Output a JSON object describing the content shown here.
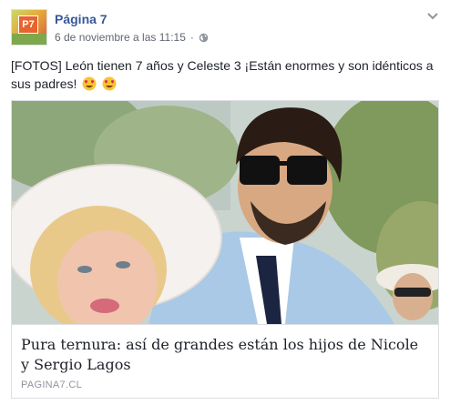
{
  "header": {
    "page_name": "Página 7",
    "timestamp": "6 de noviembre a las 11:15",
    "separator": "·",
    "avatar_text": "P7"
  },
  "post": {
    "text": "[FOTOS] León tienen 7 años y Celeste 3 ¡Están enormes y son idénticos a sus padres!",
    "emojis": [
      "heart-eyes-emoji",
      "heart-eyes-emoji"
    ]
  },
  "link_card": {
    "title": "Pura ternura: así de grandes están los hijos de Nicole y Sergio Lagos",
    "domain": "PAGINA7.CL"
  },
  "icons": {
    "privacy": "globe-icon",
    "options": "chevron-down-icon"
  },
  "colors": {
    "link_blue": "#365899",
    "meta_gray": "#616770",
    "border": "#dddfe2",
    "domain_gray": "#90949c"
  }
}
